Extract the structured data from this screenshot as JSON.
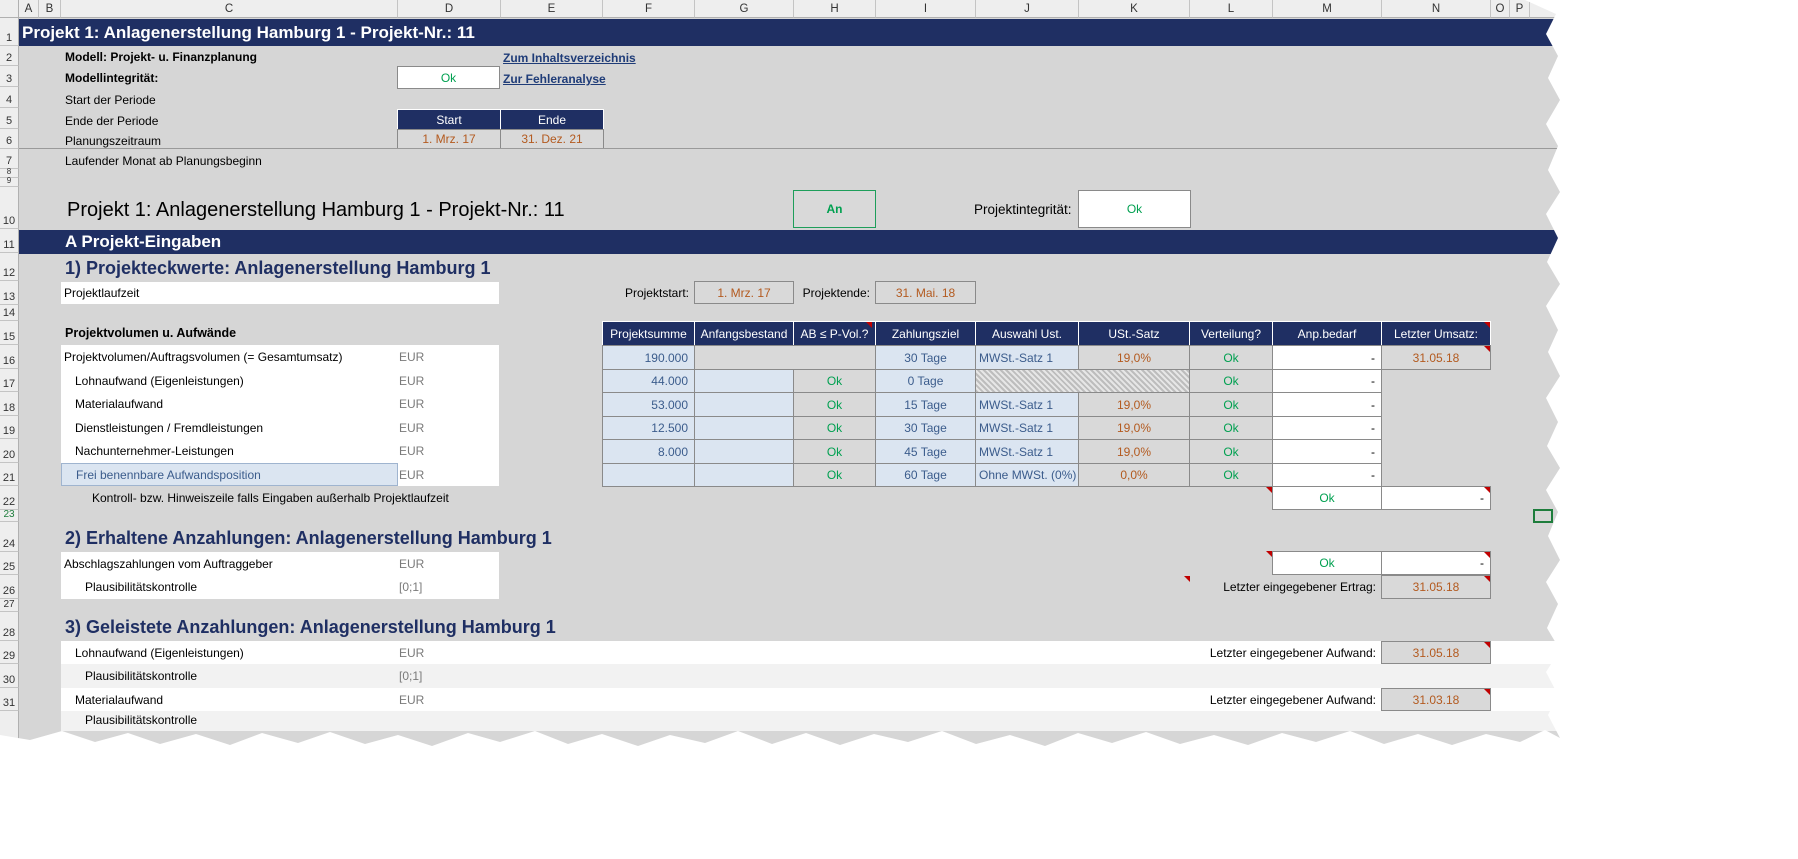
{
  "columns": [
    "A",
    "B",
    "C",
    "D",
    "E",
    "F",
    "G",
    "H",
    "I",
    "J",
    "K",
    "L",
    "M",
    "N",
    "O",
    "P"
  ],
  "rows": [
    "1",
    "2",
    "3",
    "4",
    "5",
    "6",
    "7",
    "8",
    "9",
    "10",
    "11",
    "12",
    "13",
    "14",
    "15",
    "16",
    "17",
    "18",
    "19",
    "20",
    "21",
    "22",
    "23",
    "24",
    "25",
    "26",
    "27",
    "28",
    "29",
    "30",
    "31"
  ],
  "title_bar": "Projekt 1: Anlagenerstellung Hamburg 1 - Projekt-Nr.: 11",
  "model_label": "Modell: Projekt- u. Finanzplanung",
  "integrity_label": "Modellintegrität:",
  "integrity_value": "Ok",
  "link_toc": "Zum Inhaltsverzeichnis",
  "link_errors": "Zur Fehleranalyse",
  "period_start_label": "Start der Periode",
  "period_end_label": "Ende der Periode",
  "planning_label": "Planungszeitraum",
  "running_month_label": "Laufender Monat ab Planungsbeginn",
  "period_header_start": "Start",
  "period_header_end": "Ende",
  "period_start_value": "1. Mrz. 17",
  "period_end_value": "31. Dez. 21",
  "project_heading": "Projekt 1: Anlagenerstellung Hamburg 1 - Projekt-Nr.: 11",
  "toggle_value": "An",
  "project_integrity_label": "Projektintegrität:",
  "project_integrity_value": "Ok",
  "section_a": "A  Projekt-Eingaben",
  "section1_title": "1) Projekteckwerte: Anlagenerstellung Hamburg 1",
  "runtime_label": "Projektlaufzeit",
  "projectstart_label": "Projektstart:",
  "projectstart_value": "1. Mrz. 17",
  "projectend_label": "Projektende:",
  "projectend_value": "31. Mai. 18",
  "volume_heading": "Projektvolumen u. Aufwände",
  "table_headers": [
    "Projektsumme",
    "Anfangsbestand",
    "AB ≤ P-Vol.?",
    "Zahlungsziel",
    "Auswahl Ust.",
    "USt.-Satz",
    "Verteilung?",
    "Anp.bedarf",
    "Letzter Umsatz:"
  ],
  "table_rows": [
    {
      "label": "Projektvolumen/Auftragsvolumen (= Gesamtumsatz)",
      "unit": "EUR",
      "sum": "190.000",
      "start": "",
      "ab": "",
      "term": "30 Tage",
      "vat": "MWSt.-Satz 1",
      "rate": "19,0%",
      "dist": "Ok",
      "adj": "-",
      "last": "31.05.18"
    },
    {
      "label": "Lohnaufwand (Eigenleistungen)",
      "unit": "EUR",
      "sum": "44.000",
      "start": "",
      "ab": "Ok",
      "term": "0 Tage",
      "vat": "",
      "rate": "",
      "dist": "Ok",
      "adj": "-",
      "last": ""
    },
    {
      "label": "Materialaufwand",
      "unit": "EUR",
      "sum": "53.000",
      "start": "",
      "ab": "Ok",
      "term": "15 Tage",
      "vat": "MWSt.-Satz 1",
      "rate": "19,0%",
      "dist": "Ok",
      "adj": "-",
      "last": ""
    },
    {
      "label": "Dienstleistungen / Fremdleistungen",
      "unit": "EUR",
      "sum": "12.500",
      "start": "",
      "ab": "Ok",
      "term": "30 Tage",
      "vat": "MWSt.-Satz 1",
      "rate": "19,0%",
      "dist": "Ok",
      "adj": "-",
      "last": ""
    },
    {
      "label": "Nachunternehmer-Leistungen",
      "unit": "EUR",
      "sum": "8.000",
      "start": "",
      "ab": "Ok",
      "term": "45 Tage",
      "vat": "MWSt.-Satz 1",
      "rate": "19,0%",
      "dist": "Ok",
      "adj": "-",
      "last": ""
    },
    {
      "label": "Frei benennbare Aufwandsposition",
      "unit": "EUR",
      "sum": "",
      "start": "",
      "ab": "Ok",
      "term": "60 Tage",
      "vat": "Ohne MWSt. (0%)",
      "rate": "0,0%",
      "dist": "Ok",
      "adj": "-",
      "last": ""
    }
  ],
  "control_row_label": "Kontroll- bzw. Hinweiszeile falls Eingaben außerhalb Projektlaufzeit",
  "control_ok": "Ok",
  "control_dash": "-",
  "section2_title": "2) Erhaltene Anzahlungen: Anlagenerstellung Hamburg 1",
  "advance_label": "Abschlagszahlungen vom Auftraggeber",
  "advance_unit": "EUR",
  "plaus_label": "Plausibilitätskontrolle",
  "plaus_unit": "[0;1]",
  "advance_ok": "Ok",
  "advance_dash": "-",
  "last_income_label": "Letzter eingegebener Ertrag:",
  "last_income_value": "31.05.18",
  "section3_title": "3) Geleistete Anzahlungen: Anlagenerstellung Hamburg 1",
  "s3_row29_label": "Lohnaufwand (Eigenleistungen)",
  "s3_row29_unit": "EUR",
  "s3_row30_label": "Plausibilitätskontrolle",
  "s3_row30_unit": "[0;1]",
  "s3_row31_label": "Materialaufwand",
  "s3_row31_unit": "EUR",
  "last_expense_label": "Letzter eingegebener Aufwand:",
  "last_expense_value1": "31.05.18",
  "last_expense_value2": "31.03.18",
  "cut_text": "Plausibilitätskontrolle"
}
